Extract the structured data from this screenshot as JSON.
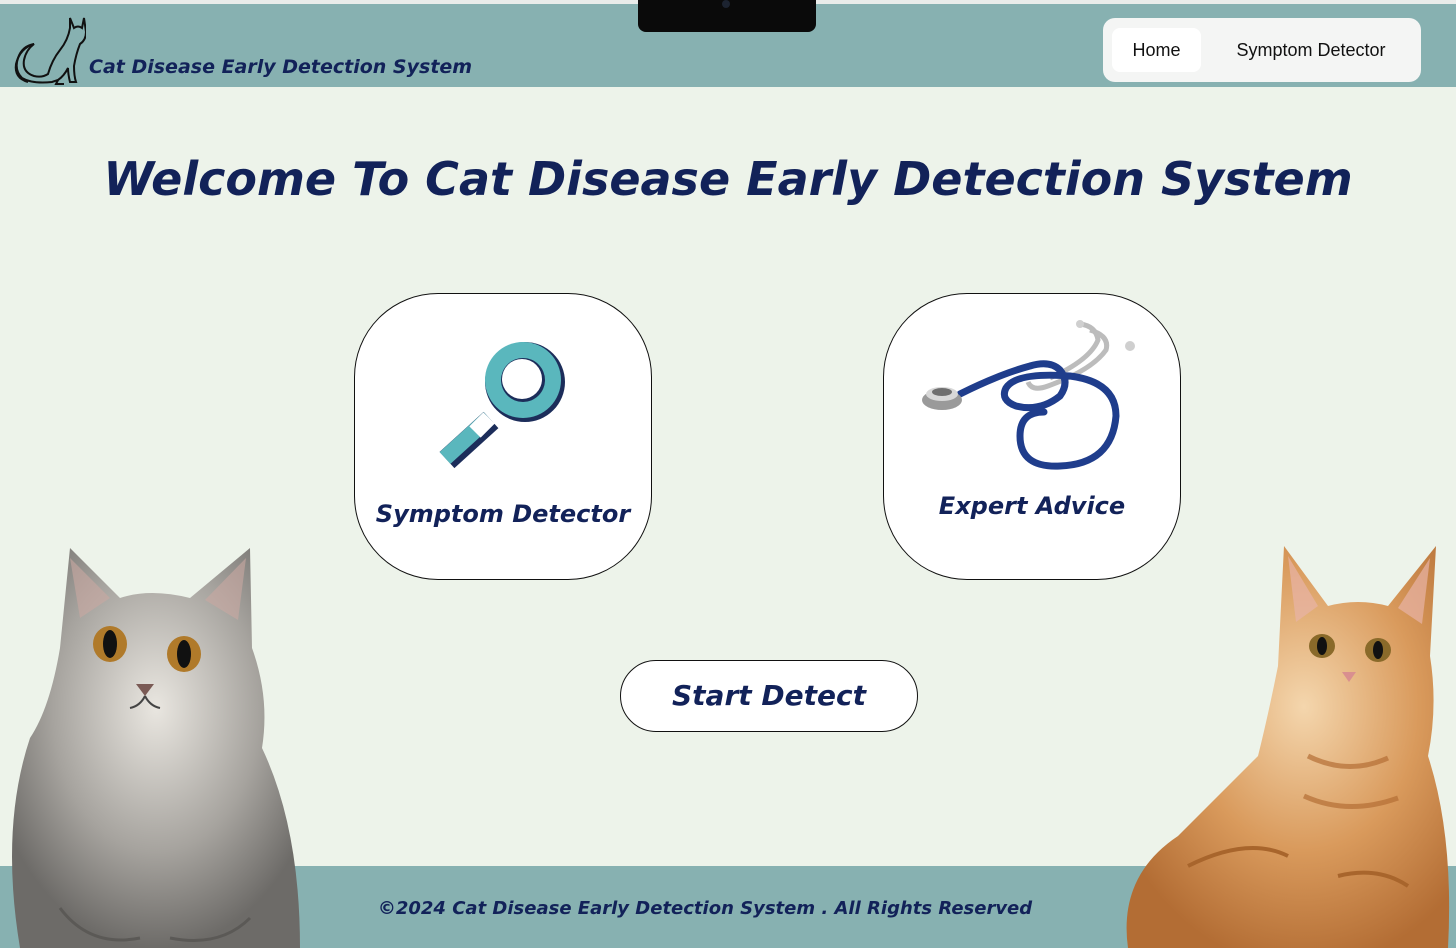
{
  "header": {
    "brand_title": "Cat Disease Early Detection System",
    "nav": {
      "home_label": "Home",
      "symptom_detector_label": "Symptom Detector"
    }
  },
  "main": {
    "welcome_heading": "Welcome To Cat Disease Early Detection System",
    "cards": {
      "symptom_detector": "Symptom Detector",
      "expert_advice": "Expert Advice"
    },
    "start_button": "Start Detect"
  },
  "footer": {
    "copyright": "©2024  Cat Disease Early Detection System .  All Rights Reserved"
  },
  "colors": {
    "header_bg": "#87b1b1",
    "page_bg": "#edf3ea",
    "heading": "#122259",
    "magnifier": "#5ab7bd",
    "stethoscope": "#1f3d8c"
  },
  "icons": [
    "cat-outline-logo-icon",
    "magnifying-glass-icon",
    "stethoscope-icon"
  ]
}
